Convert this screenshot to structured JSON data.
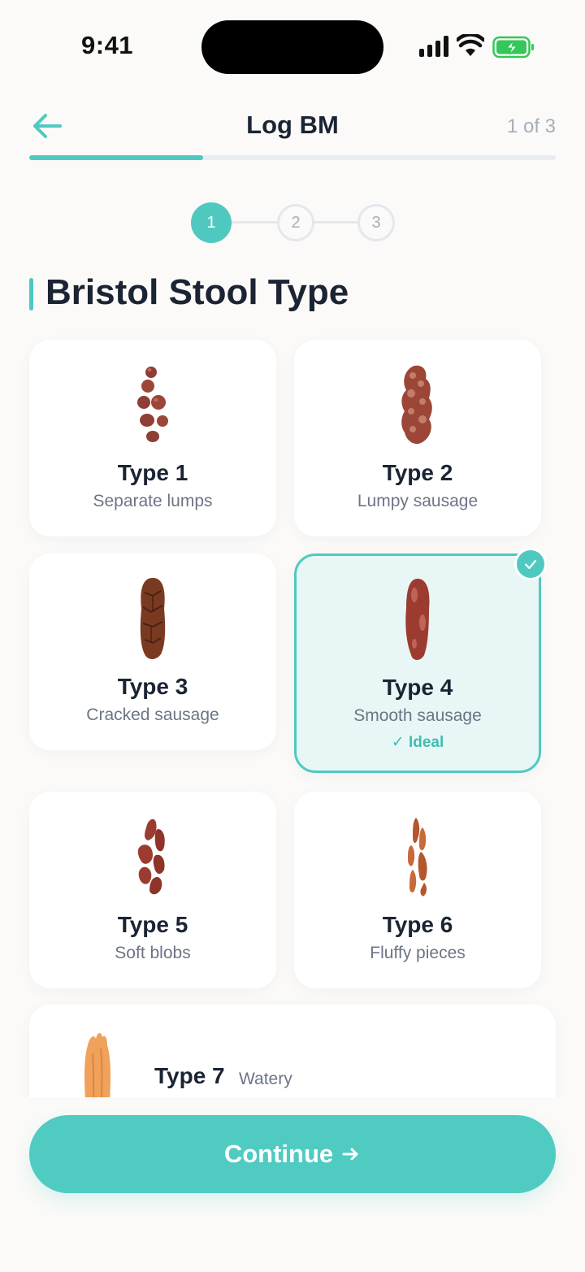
{
  "status_bar": {
    "time": "9:41"
  },
  "header": {
    "title": "Log BM",
    "step_counter": "1 of 3",
    "progress_fraction": 0.33
  },
  "stepper": {
    "steps": [
      "1",
      "2",
      "3"
    ],
    "active_step": 1
  },
  "section": {
    "title": "Bristol Stool Type"
  },
  "types": [
    {
      "name": "Type 1",
      "description": "Separate lumps",
      "icon": "type-1-stool-icon"
    },
    {
      "name": "Type 2",
      "description": "Lumpy sausage",
      "icon": "type-2-stool-icon"
    },
    {
      "name": "Type 3",
      "description": "Cracked sausage",
      "icon": "type-3-stool-icon"
    },
    {
      "name": "Type 4",
      "description": "Smooth sausage",
      "badge": "✓ Ideal",
      "selected": true,
      "icon": "type-4-stool-icon"
    },
    {
      "name": "Type 5",
      "description": "Soft blobs",
      "icon": "type-5-stool-icon"
    },
    {
      "name": "Type 6",
      "description": "Fluffy pieces",
      "icon": "type-6-stool-icon"
    },
    {
      "name": "Type 7",
      "description": "Watery",
      "icon": "type-7-stool-icon"
    }
  ],
  "footer": {
    "continue_label": "Continue"
  },
  "colors": {
    "accent": "#4fc9c0",
    "selected_bg": "#e8f7f5",
    "text": "#1b2433",
    "muted": "#6b7584"
  }
}
